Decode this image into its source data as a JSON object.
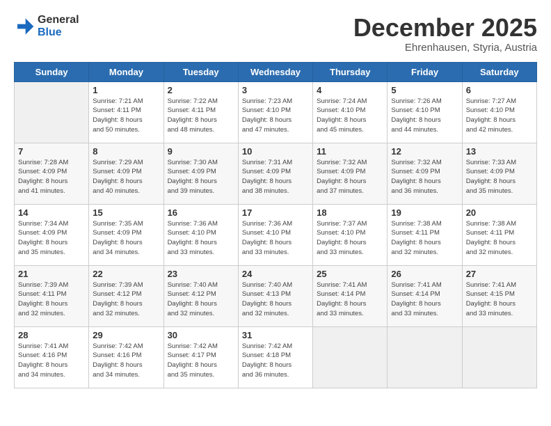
{
  "header": {
    "logo_line1": "General",
    "logo_line2": "Blue",
    "month_title": "December 2025",
    "subtitle": "Ehrenhausen, Styria, Austria"
  },
  "days_of_week": [
    "Sunday",
    "Monday",
    "Tuesday",
    "Wednesday",
    "Thursday",
    "Friday",
    "Saturday"
  ],
  "weeks": [
    [
      {
        "day": "",
        "info": ""
      },
      {
        "day": "1",
        "info": "Sunrise: 7:21 AM\nSunset: 4:11 PM\nDaylight: 8 hours\nand 50 minutes."
      },
      {
        "day": "2",
        "info": "Sunrise: 7:22 AM\nSunset: 4:11 PM\nDaylight: 8 hours\nand 48 minutes."
      },
      {
        "day": "3",
        "info": "Sunrise: 7:23 AM\nSunset: 4:10 PM\nDaylight: 8 hours\nand 47 minutes."
      },
      {
        "day": "4",
        "info": "Sunrise: 7:24 AM\nSunset: 4:10 PM\nDaylight: 8 hours\nand 45 minutes."
      },
      {
        "day": "5",
        "info": "Sunrise: 7:26 AM\nSunset: 4:10 PM\nDaylight: 8 hours\nand 44 minutes."
      },
      {
        "day": "6",
        "info": "Sunrise: 7:27 AM\nSunset: 4:10 PM\nDaylight: 8 hours\nand 42 minutes."
      }
    ],
    [
      {
        "day": "7",
        "info": "Sunrise: 7:28 AM\nSunset: 4:09 PM\nDaylight: 8 hours\nand 41 minutes."
      },
      {
        "day": "8",
        "info": "Sunrise: 7:29 AM\nSunset: 4:09 PM\nDaylight: 8 hours\nand 40 minutes."
      },
      {
        "day": "9",
        "info": "Sunrise: 7:30 AM\nSunset: 4:09 PM\nDaylight: 8 hours\nand 39 minutes."
      },
      {
        "day": "10",
        "info": "Sunrise: 7:31 AM\nSunset: 4:09 PM\nDaylight: 8 hours\nand 38 minutes."
      },
      {
        "day": "11",
        "info": "Sunrise: 7:32 AM\nSunset: 4:09 PM\nDaylight: 8 hours\nand 37 minutes."
      },
      {
        "day": "12",
        "info": "Sunrise: 7:32 AM\nSunset: 4:09 PM\nDaylight: 8 hours\nand 36 minutes."
      },
      {
        "day": "13",
        "info": "Sunrise: 7:33 AM\nSunset: 4:09 PM\nDaylight: 8 hours\nand 35 minutes."
      }
    ],
    [
      {
        "day": "14",
        "info": "Sunrise: 7:34 AM\nSunset: 4:09 PM\nDaylight: 8 hours\nand 35 minutes."
      },
      {
        "day": "15",
        "info": "Sunrise: 7:35 AM\nSunset: 4:09 PM\nDaylight: 8 hours\nand 34 minutes."
      },
      {
        "day": "16",
        "info": "Sunrise: 7:36 AM\nSunset: 4:10 PM\nDaylight: 8 hours\nand 33 minutes."
      },
      {
        "day": "17",
        "info": "Sunrise: 7:36 AM\nSunset: 4:10 PM\nDaylight: 8 hours\nand 33 minutes."
      },
      {
        "day": "18",
        "info": "Sunrise: 7:37 AM\nSunset: 4:10 PM\nDaylight: 8 hours\nand 33 minutes."
      },
      {
        "day": "19",
        "info": "Sunrise: 7:38 AM\nSunset: 4:11 PM\nDaylight: 8 hours\nand 32 minutes."
      },
      {
        "day": "20",
        "info": "Sunrise: 7:38 AM\nSunset: 4:11 PM\nDaylight: 8 hours\nand 32 minutes."
      }
    ],
    [
      {
        "day": "21",
        "info": "Sunrise: 7:39 AM\nSunset: 4:11 PM\nDaylight: 8 hours\nand 32 minutes."
      },
      {
        "day": "22",
        "info": "Sunrise: 7:39 AM\nSunset: 4:12 PM\nDaylight: 8 hours\nand 32 minutes."
      },
      {
        "day": "23",
        "info": "Sunrise: 7:40 AM\nSunset: 4:12 PM\nDaylight: 8 hours\nand 32 minutes."
      },
      {
        "day": "24",
        "info": "Sunrise: 7:40 AM\nSunset: 4:13 PM\nDaylight: 8 hours\nand 32 minutes."
      },
      {
        "day": "25",
        "info": "Sunrise: 7:41 AM\nSunset: 4:14 PM\nDaylight: 8 hours\nand 33 minutes."
      },
      {
        "day": "26",
        "info": "Sunrise: 7:41 AM\nSunset: 4:14 PM\nDaylight: 8 hours\nand 33 minutes."
      },
      {
        "day": "27",
        "info": "Sunrise: 7:41 AM\nSunset: 4:15 PM\nDaylight: 8 hours\nand 33 minutes."
      }
    ],
    [
      {
        "day": "28",
        "info": "Sunrise: 7:41 AM\nSunset: 4:16 PM\nDaylight: 8 hours\nand 34 minutes."
      },
      {
        "day": "29",
        "info": "Sunrise: 7:42 AM\nSunset: 4:16 PM\nDaylight: 8 hours\nand 34 minutes."
      },
      {
        "day": "30",
        "info": "Sunrise: 7:42 AM\nSunset: 4:17 PM\nDaylight: 8 hours\nand 35 minutes."
      },
      {
        "day": "31",
        "info": "Sunrise: 7:42 AM\nSunset: 4:18 PM\nDaylight: 8 hours\nand 36 minutes."
      },
      {
        "day": "",
        "info": ""
      },
      {
        "day": "",
        "info": ""
      },
      {
        "day": "",
        "info": ""
      }
    ]
  ]
}
